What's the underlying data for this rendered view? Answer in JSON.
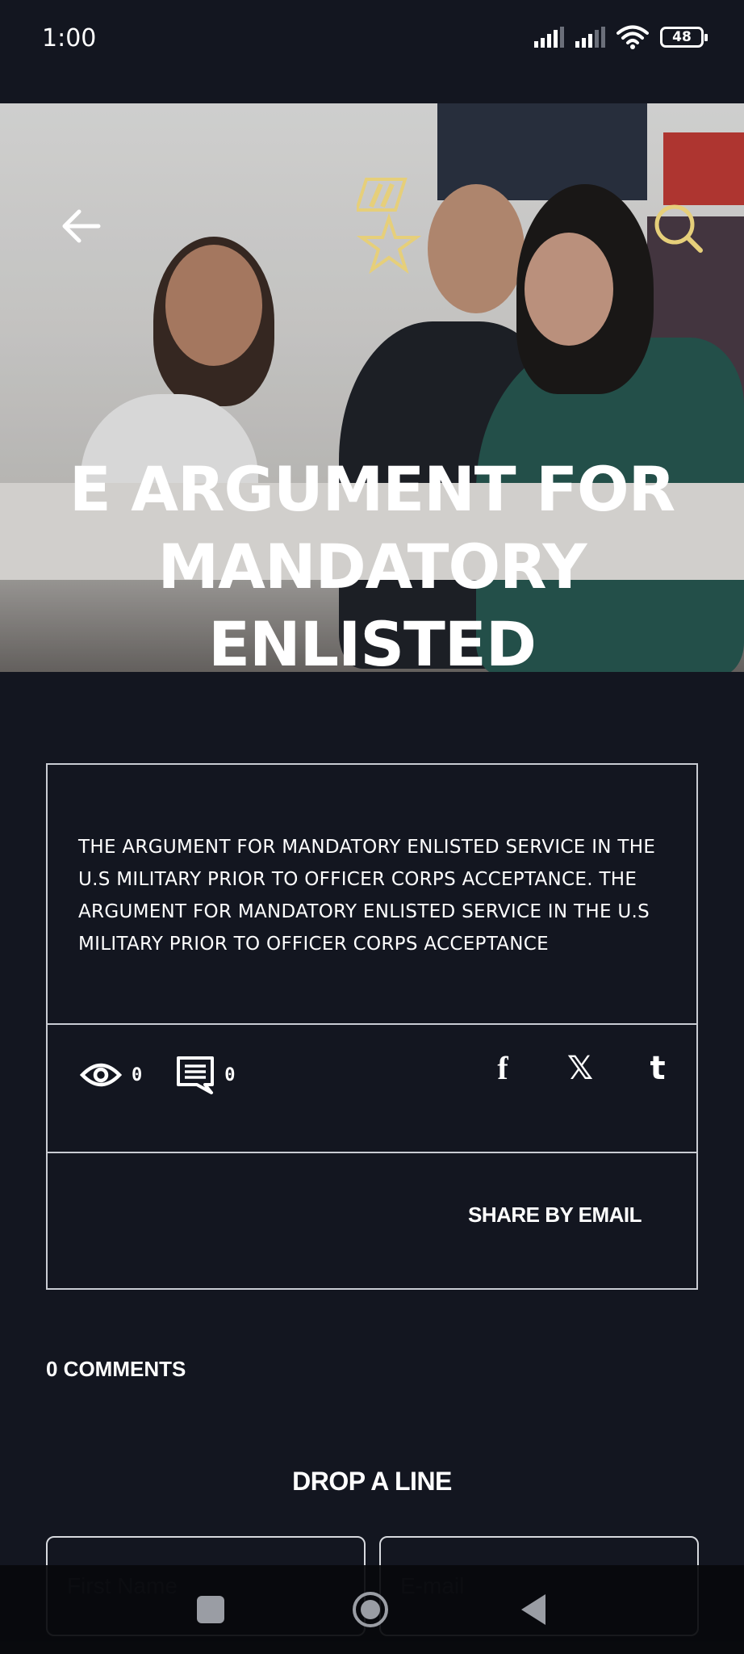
{
  "status_bar": {
    "time": "1:00",
    "battery": "48"
  },
  "hero": {
    "title": "E ARGUMENT FOR MANDATORY ENLISTED SERVICE...",
    "back_icon": "arrow-left-icon",
    "search_icon": "search-icon",
    "logo_icon": "medal-star-icon"
  },
  "post": {
    "excerpt": " THE ARGUMENT FOR MANDATORY ENLISTED SERVICE IN THE U.S MILITARY PRIOR TO OFFICER CORPS ACCEPTANCE.  THE ARGUMENT FOR MANDATORY ENLISTED SERVICE IN THE U.S MILITARY PRIOR TO OFFICER CORPS ACCEPTANCE",
    "views": "0",
    "comments": "0",
    "socials": {
      "facebook": "f",
      "x": "𝕏",
      "tumblr": "t"
    },
    "share_email_label": "SHARE BY EMAIL"
  },
  "comments_section": {
    "count_label": "0 COMMENTS",
    "form_title": "DROP A LINE",
    "first_name_placeholder": "First Name",
    "email_placeholder": "E-mail"
  },
  "colors": {
    "background": "#131620",
    "border": "#c9ccd3",
    "text": "#ffffff",
    "accent_gold": "#e6cf7a"
  }
}
